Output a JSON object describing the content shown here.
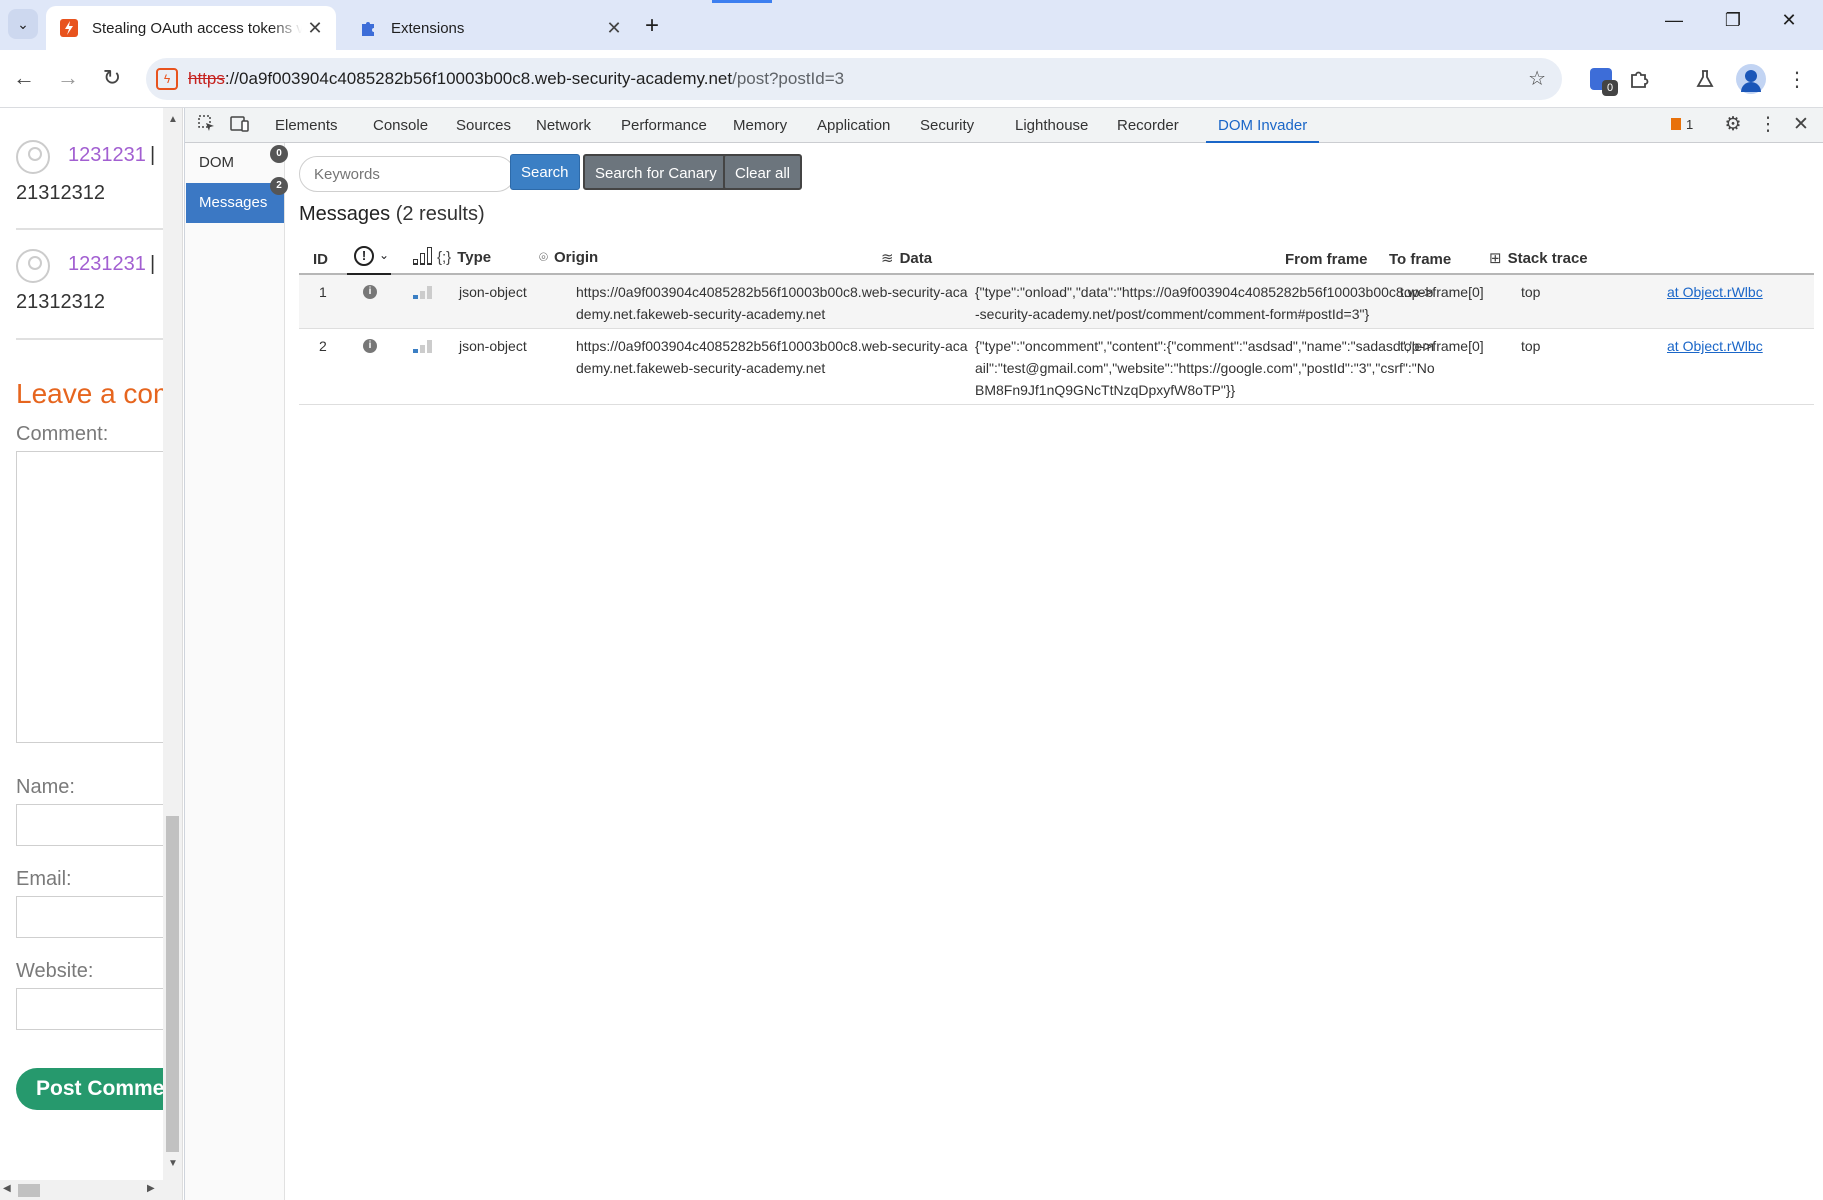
{
  "browser": {
    "tabs": [
      {
        "title": "Stealing OAuth access tokens via",
        "favicon": "lightning-icon",
        "active": true
      },
      {
        "title": "Extensions",
        "favicon": "puzzle-icon",
        "active": false
      }
    ],
    "url": {
      "scheme": "https",
      "host": "://0a9f003904c4085282b56f10003b00c8.web-security-academy.net",
      "path": "/post?postId=3"
    },
    "extension_badge": "0"
  },
  "page": {
    "comments": [
      {
        "author": "1231231",
        "separator": "|",
        "body": "21312312"
      },
      {
        "author": "1231231",
        "separator": "|",
        "body": "21312312"
      }
    ],
    "leave_comment_heading": "Leave a comment",
    "labels": {
      "comment": "Comment:",
      "name": "Name:",
      "email": "Email:",
      "website": "Website:"
    },
    "post_button": "Post Comment"
  },
  "devtools": {
    "tabs": [
      "Elements",
      "Console",
      "Sources",
      "Network",
      "Performance",
      "Memory",
      "Application",
      "Security",
      "Lighthouse",
      "Recorder",
      "DOM Invader"
    ],
    "active_tab": "DOM Invader",
    "issues_count": "1",
    "dom_invader": {
      "nav": [
        {
          "label": "DOM",
          "badge": "0"
        },
        {
          "label": "Messages",
          "badge": "2"
        }
      ],
      "search_placeholder": "Keywords",
      "buttons": {
        "search": "Search",
        "canary": "Search for Canary",
        "clear": "Clear all"
      },
      "messages_title": "Messages",
      "results_count": "(2 results)",
      "columns": {
        "id": "ID",
        "type": "Type",
        "origin": "Origin",
        "data": "Data",
        "from_frame": "From frame",
        "to_frame": "To frame",
        "stack_trace": "Stack trace"
      },
      "rows": [
        {
          "id": "1",
          "severity": "i",
          "type": "json-object",
          "origin": "https://0a9f003904c4085282b56f10003b00c8.web-security-academy.net.fakeweb-security-academy.net",
          "data": "{\"type\":\"onload\",\"data\":\"https://0a9f003904c4085282b56f10003b00c8.web-security-academy.net/post/comment/comment-form#postId=3\"}",
          "from_frame": "top->frame[0]",
          "to_frame": "top",
          "stack_trace": "at Object.rWlbc"
        },
        {
          "id": "2",
          "severity": "i",
          "type": "json-object",
          "origin": "https://0a9f003904c4085282b56f10003b00c8.web-security-academy.net.fakeweb-security-academy.net",
          "data": "{\"type\":\"oncomment\",\"content\":{\"comment\":\"asdsad\",\"name\":\"sadasd\",\"email\":\"test@gmail.com\",\"website\":\"https://google.com\",\"postId\":\"3\",\"csrf\":\"NoBM8Fn9Jf1nQ9GNcTtNzqDpxyfW8oTP\"}}",
          "from_frame": "top->frame[0]",
          "to_frame": "top",
          "stack_trace": "at Object.rWlbc"
        }
      ]
    }
  },
  "colors": {
    "accent": "#1a66c8",
    "primary_button": "#3b7fc4",
    "post_button": "#26996d",
    "heading_orange": "#e6651e",
    "author_purple": "#a25fd1"
  }
}
